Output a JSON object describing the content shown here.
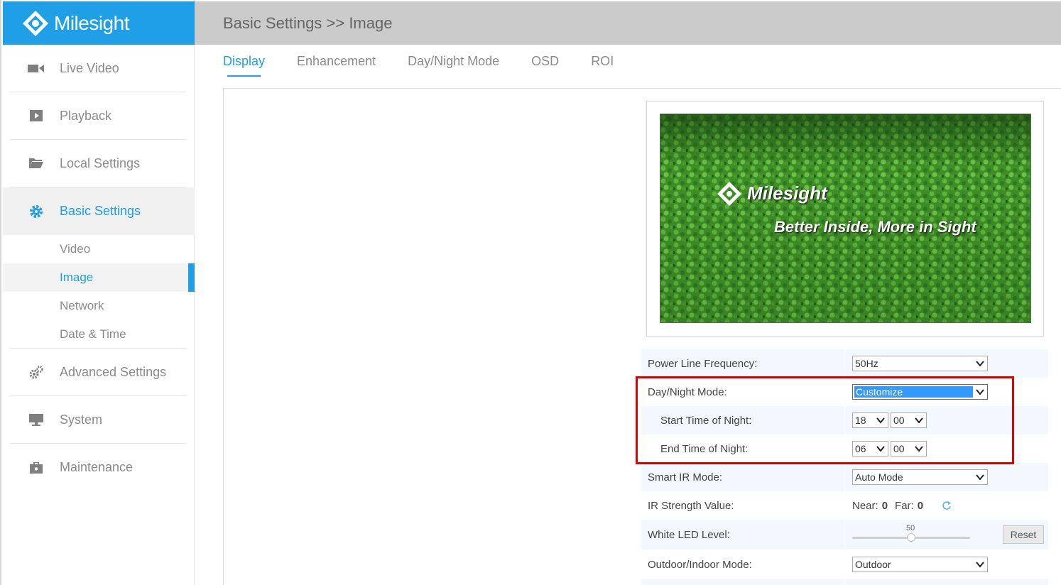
{
  "brand": {
    "name": "Milesight"
  },
  "header": {
    "breadcrumb": "Basic Settings >> Image"
  },
  "sidebar": {
    "items": [
      {
        "label": "Live Video",
        "icon": "video-camera-icon"
      },
      {
        "label": "Playback",
        "icon": "play-icon"
      },
      {
        "label": "Local Settings",
        "icon": "folder-icon"
      },
      {
        "label": "Basic Settings",
        "icon": "gear-icon"
      },
      {
        "label": "Advanced Settings",
        "icon": "gears-icon"
      },
      {
        "label": "System",
        "icon": "monitor-icon"
      },
      {
        "label": "Maintenance",
        "icon": "toolbox-icon"
      }
    ],
    "sub_items": [
      "Video",
      "Image",
      "Network",
      "Date & Time"
    ]
  },
  "tabs": [
    "Display",
    "Enhancement",
    "Day/Night Mode",
    "OSD",
    "ROI"
  ],
  "preview": {
    "logo_text": "Milesight",
    "slogan": "Better Inside, More in Sight"
  },
  "settings": {
    "power_line_frequency": {
      "label": "Power Line Frequency:",
      "value": "50Hz"
    },
    "day_night_mode": {
      "label": "Day/Night Mode:",
      "value": "Customize"
    },
    "start_time_of_night": {
      "label": "Start Time of Night:",
      "hour": "18",
      "minute": "00"
    },
    "end_time_of_night": {
      "label": "End Time of Night:",
      "hour": "06",
      "minute": "00"
    },
    "smart_ir_mode": {
      "label": "Smart IR Mode:",
      "value": "Auto Mode"
    },
    "ir_strength": {
      "label": "IR Strength Value:",
      "near_label": "Near:",
      "near_value": "0",
      "far_label": "Far:",
      "far_value": "0"
    },
    "white_led_level": {
      "label": "White LED Level:",
      "value": 50,
      "value_text": "50",
      "min": 0,
      "max": 100,
      "reset_label": "Reset"
    },
    "outdoor_indoor_mode": {
      "label": "Outdoor/Indoor Mode:",
      "value": "Outdoor"
    }
  },
  "colors": {
    "accent": "#1e9fe6",
    "header_bg": "#cbcbcb",
    "highlight_border": "#e00000"
  }
}
